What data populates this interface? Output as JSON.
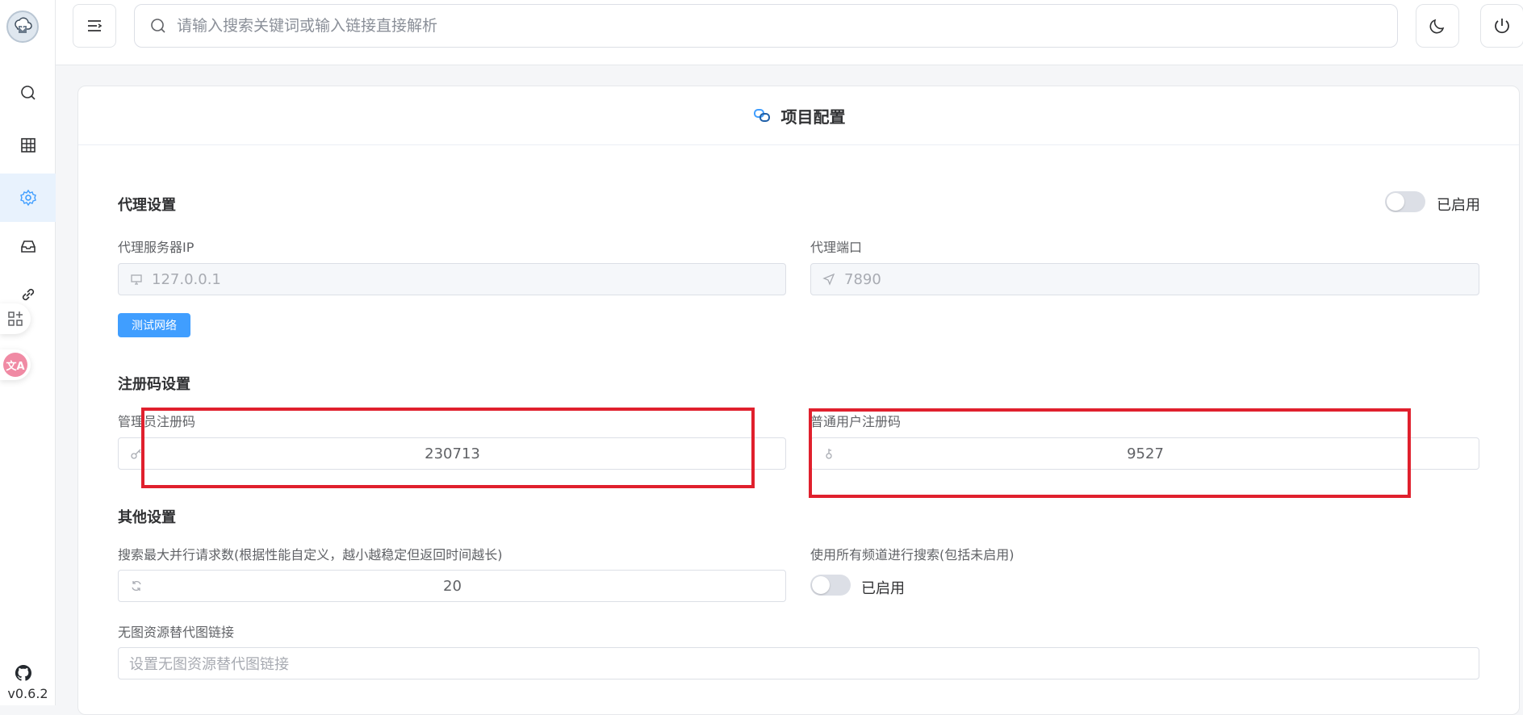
{
  "sidebar": {
    "version": "v0.6.2",
    "items": [
      {
        "icon": "search-icon"
      },
      {
        "icon": "table-icon"
      },
      {
        "icon": "gear-icon",
        "active": true
      },
      {
        "icon": "inbox-icon"
      },
      {
        "icon": "link-icon"
      }
    ]
  },
  "header": {
    "search_placeholder": "请输入搜索关键词或输入链接直接解析"
  },
  "card": {
    "title": "项目配置"
  },
  "proxy": {
    "title": "代理设置",
    "switch_label": "已启用",
    "ip_label": "代理服务器IP",
    "ip_value": "127.0.0.1",
    "port_label": "代理端口",
    "port_value": "7890",
    "test_button": "测试网络"
  },
  "register": {
    "title": "注册码设置",
    "admin_label": "管理员注册码",
    "admin_value": "230713",
    "user_label": "普通用户注册码",
    "user_value": "9527"
  },
  "other": {
    "title": "其他设置",
    "concurrency_label": "搜索最大并行请求数(根据性能自定义，越小越稳定但返回时间越长)",
    "concurrency_value": "20",
    "all_channels_label": "使用所有频道进行搜索(包括未启用)",
    "all_channels_switch_label": "已启用",
    "fallback_image_label": "无图资源替代图链接",
    "fallback_image_placeholder": "设置无图资源替代图链接"
  },
  "colors": {
    "primary": "#409eff",
    "highlight": "#e0202d"
  }
}
